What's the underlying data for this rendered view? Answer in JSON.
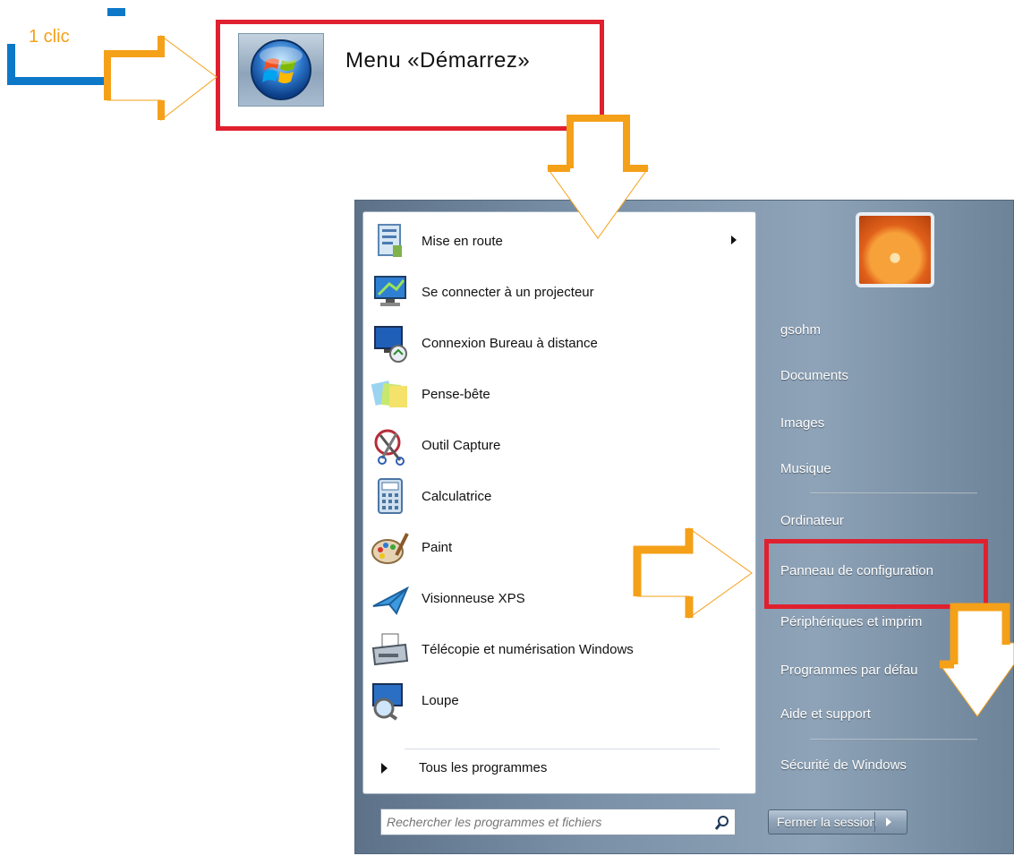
{
  "annotation": {
    "clic_label": "1 clic",
    "menu_title": "Menu «Démarrez»"
  },
  "start_menu": {
    "programs": [
      {
        "label": "Mise en route",
        "icon": "getting-started-icon",
        "has_submenu": true
      },
      {
        "label": "Se connecter à un projecteur",
        "icon": "projector-icon"
      },
      {
        "label": "Connexion Bureau à distance",
        "icon": "remote-desktop-icon"
      },
      {
        "label": "Pense-bête",
        "icon": "sticky-notes-icon"
      },
      {
        "label": "Outil Capture",
        "icon": "snipping-tool-icon"
      },
      {
        "label": "Calculatrice",
        "icon": "calculator-icon"
      },
      {
        "label": "Paint",
        "icon": "paint-icon"
      },
      {
        "label": "Visionneuse XPS",
        "icon": "xps-viewer-icon"
      },
      {
        "label": "Télécopie et numérisation Windows",
        "icon": "fax-scan-icon"
      },
      {
        "label": "Loupe",
        "icon": "magnifier-icon"
      }
    ],
    "all_programs": "Tous les programmes",
    "search": {
      "placeholder": "Rechercher les programmes et fichiers"
    },
    "right_items": [
      {
        "label": "gsohm"
      },
      {
        "label": "Documents"
      },
      {
        "label": "Images"
      },
      {
        "label": "Musique"
      },
      {
        "label": "Ordinateur"
      },
      {
        "label": "Panneau de configuration"
      },
      {
        "label": "Périphériques et imprim"
      },
      {
        "label": "Programmes par défau"
      },
      {
        "label": "Aide et support"
      },
      {
        "label": "Sécurité de Windows"
      }
    ],
    "logoff": "Fermer la session"
  },
  "colors": {
    "highlight_red": "#e0202f",
    "arrow_orange": "#f5a019",
    "clic_blue": "#0e78c8"
  }
}
